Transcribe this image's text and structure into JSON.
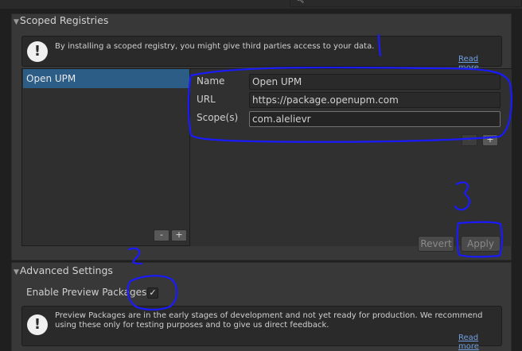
{
  "toolbar": {
    "search_icon": "search-icon"
  },
  "scoped_registries": {
    "title": "Scoped Registries",
    "warning": "By installing a scoped registry, you might give third parties access to your data.",
    "read_more": "Read more",
    "registries": [
      {
        "name": "Open UPM"
      }
    ],
    "fields": {
      "name_label": "Name",
      "name_value": "Open UPM",
      "url_label": "URL",
      "url_value": "https://package.openupm.com",
      "scopes_label": "Scope(s)",
      "scopes_value": "com.alelievr"
    },
    "scope_remove": "-",
    "scope_add": "+",
    "list_remove": "-",
    "list_add": "+",
    "revert_label": "Revert",
    "apply_label": "Apply"
  },
  "advanced_settings": {
    "title": "Advanced Settings",
    "enable_preview_label": "Enable Preview Packages",
    "enable_preview_checked": true,
    "check_mark": "✓",
    "preview_info": "Preview Packages are in the early stages of development and not yet ready for production. We recommend using these only for testing purposes and to give us direct feedback.",
    "read_more": "Read more"
  },
  "annotations": {
    "mark_1": "1",
    "mark_2": "2",
    "mark_3": "3",
    "color": "#1a1aff"
  }
}
